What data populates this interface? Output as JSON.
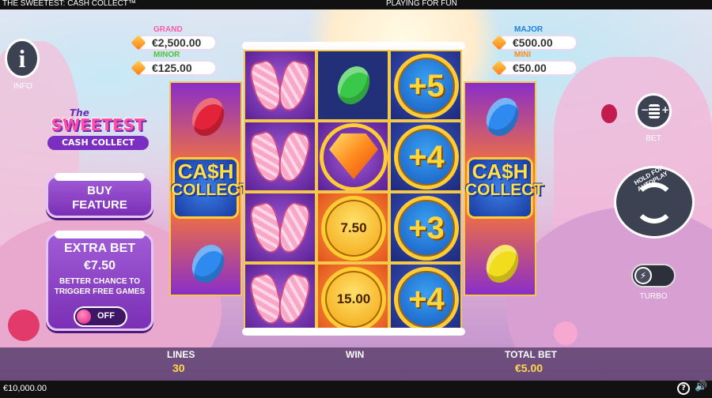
{
  "window": {
    "title": "THE SWEETEST: CASH COLLECT™",
    "mode": "PLAYING FOR FUN"
  },
  "jackpots": {
    "grand": {
      "label": "GRAND",
      "amount": "€2,500.00",
      "color": "#ff5aa8"
    },
    "minor": {
      "label": "MINOR",
      "amount": "€125.00",
      "color": "#4ec23a"
    },
    "major": {
      "label": "MAJOR",
      "amount": "€500.00",
      "color": "#1e7fe0"
    },
    "mini": {
      "label": "MINI",
      "amount": "€50.00",
      "color": "#ff8a1a"
    }
  },
  "left": {
    "info_label": "INFO",
    "logo": {
      "the": "The",
      "main": "SWEETEST",
      "sub": "CASH COLLECT"
    },
    "buy_feature": [
      "BUY",
      "FEATURE"
    ],
    "extra_bet": {
      "title": "EXTRA BET",
      "amount": "€7.50",
      "desc": [
        "BETTER CHANCE TO",
        "TRIGGER FREE GAMES"
      ],
      "toggle": "OFF"
    }
  },
  "right": {
    "bet_label": "BET",
    "autoplay_label": "HOLD FOR AUTOPLAY",
    "turbo_label": "TURBO"
  },
  "reels": {
    "cash_collect": [
      "CA$H",
      "COLLECT"
    ],
    "coins": {
      "plus5": "+5",
      "plus4a": "+4",
      "plus3": "+3",
      "plus4b": "+4",
      "v750": "7.50",
      "v1500": "15.00"
    }
  },
  "info_bar": {
    "lines_label": "LINES",
    "lines_value": "30",
    "win_label": "WIN",
    "total_bet_label": "TOTAL BET",
    "total_bet_value": "€5.00"
  },
  "status": {
    "balance": "€10,000.00"
  },
  "colors": {
    "accent_gold": "#ffd84a",
    "panel_purple": "#7b2fb5"
  }
}
